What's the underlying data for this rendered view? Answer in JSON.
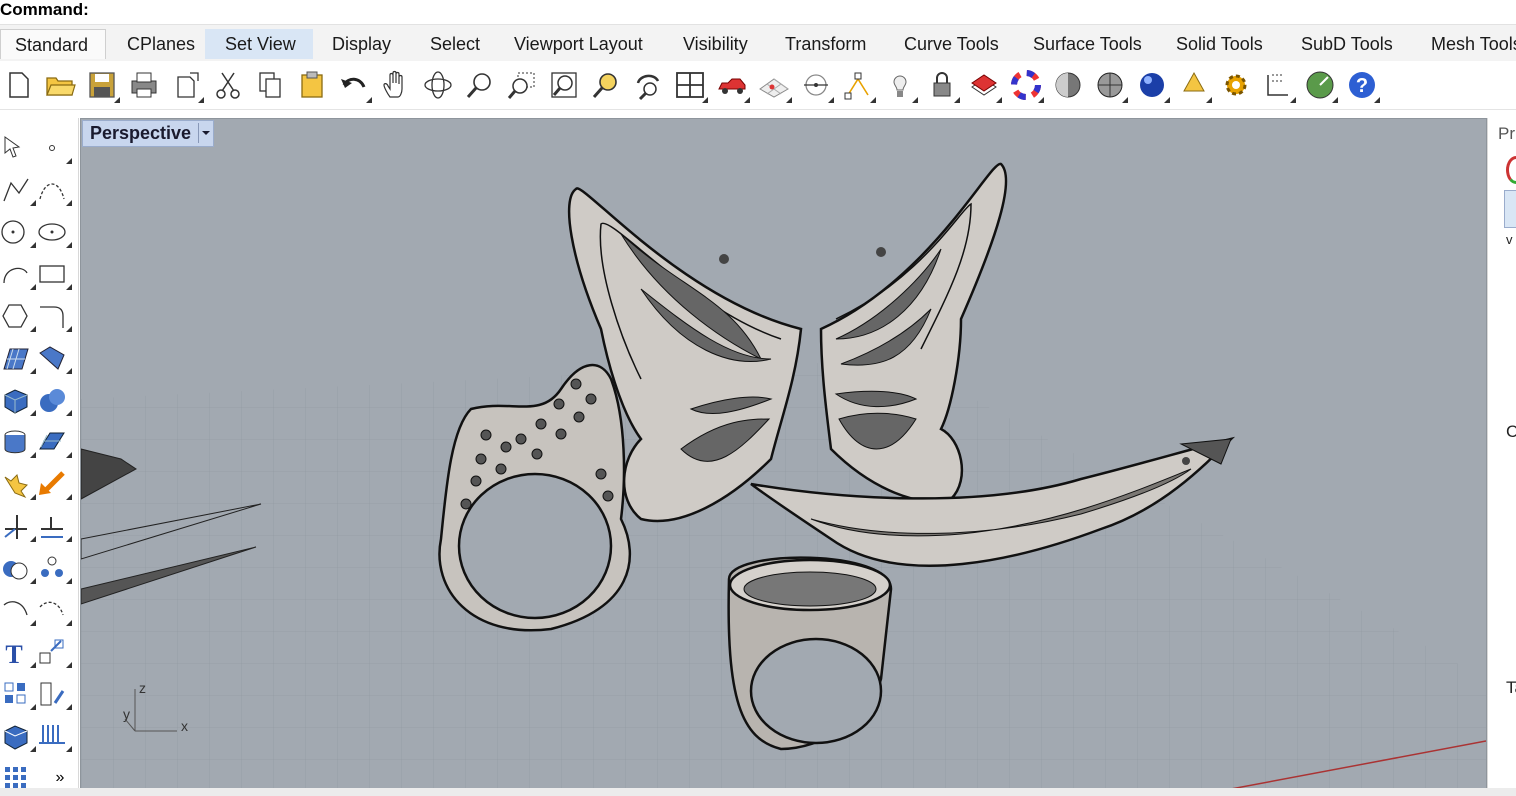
{
  "command": {
    "label": "Command:"
  },
  "tabs": [
    {
      "label": "Standard",
      "active": true
    },
    {
      "label": "CPlanes"
    },
    {
      "label": "Set View",
      "highlighted": true
    },
    {
      "label": "Display"
    },
    {
      "label": "Select"
    },
    {
      "label": "Viewport Layout"
    },
    {
      "label": "Visibility"
    },
    {
      "label": "Transform"
    },
    {
      "label": "Curve Tools"
    },
    {
      "label": "Surface Tools"
    },
    {
      "label": "Solid Tools"
    },
    {
      "label": "SubD Tools"
    },
    {
      "label": "Mesh Tools"
    }
  ],
  "toolbar_icons": [
    "new-icon",
    "open-icon",
    "save-icon",
    "print-icon",
    "import-icon",
    "cut-icon",
    "copy-icon",
    "paste-icon",
    "undo-icon",
    "pan-hand-icon",
    "rotate-view-icon",
    "zoom-icon",
    "zoom-window-icon",
    "zoom-extents-icon",
    "zoom-selected-icon",
    "rotate-camera-icon",
    "four-viewports-icon",
    "car-icon",
    "grid-snap-icon",
    "point-on-curve-icon",
    "points-icon",
    "light-icon",
    "lock-icon",
    "layer-icon",
    "color-wheel-icon",
    "render-sphere-icon",
    "shaded-sphere-icon",
    "blue-sphere-icon",
    "spotlight-icon",
    "gear-icon",
    "dimension-icon",
    "globe-icon",
    "help-icon"
  ],
  "left_tools": [
    "select-arrow-icon",
    "point-icon",
    "polyline-icon",
    "curve-icon",
    "circle-icon",
    "ellipse-icon",
    "arc-icon",
    "rectangle-icon",
    "polygon-icon",
    "fillet-icon",
    "surface-icon",
    "loft-icon",
    "box-icon",
    "sphere-icon",
    "cylinder-icon",
    "extrude-icon",
    "explode-icon",
    "arrow-move-icon",
    "trim-icon",
    "split-icon",
    "boolean-icon",
    "group-icon",
    "curve-offset-icon",
    "dim-icon",
    "text-icon",
    "transform-icon",
    "array-icon",
    "mirror-icon",
    "block-icon",
    "hatch-icon",
    "grid-icon",
    "more-icon"
  ],
  "viewport": {
    "label": "Perspective",
    "axes": {
      "z": "z",
      "y": "y",
      "x": "x"
    }
  },
  "right_panel": {
    "label1": "Pr",
    "label2": "C",
    "label3": "Ta",
    "label4": "v"
  },
  "colors": {
    "tab_highlight": "#d9e6f5",
    "viewport_bg": "#a2a9b1",
    "vp_label": "#c8d6ee"
  }
}
